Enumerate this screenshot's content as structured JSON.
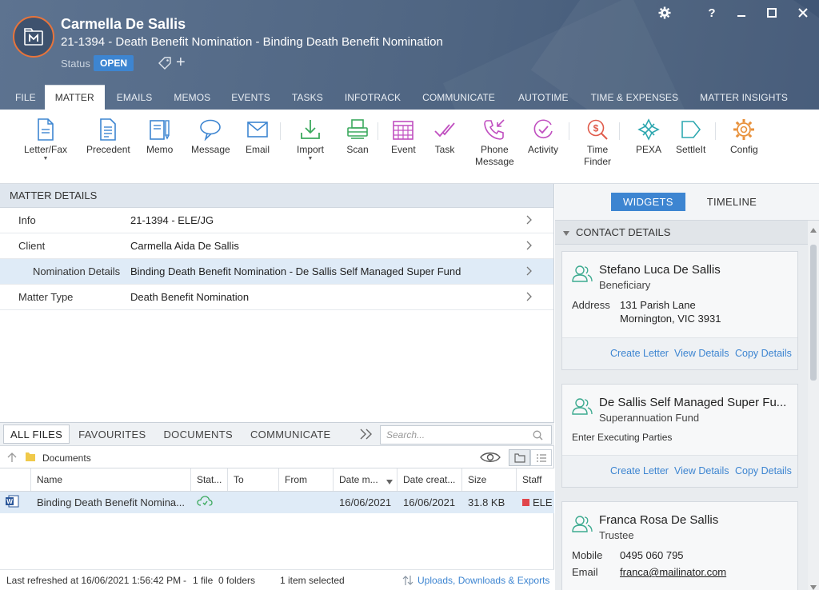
{
  "header": {
    "client_name": "Carmella De Sallis",
    "matter_title": "21-1394 - Death Benefit Nomination - Binding Death Benefit Nomination",
    "status_label": "Status",
    "status_value": "OPEN",
    "colors": {
      "accent": "#e8743b",
      "badge": "#3d85d1",
      "header_bg": "#56708f"
    }
  },
  "window_controls": {
    "settings": "gear-icon",
    "help": "?",
    "minimize": "minimize-icon",
    "maximize": "maximize-icon",
    "close": "close-icon"
  },
  "tabs": [
    {
      "label": "FILE"
    },
    {
      "label": "MATTER",
      "active": true
    },
    {
      "label": "EMAILS"
    },
    {
      "label": "MEMOS"
    },
    {
      "label": "EVENTS"
    },
    {
      "label": "TASKS"
    },
    {
      "label": "INFOTRACK"
    },
    {
      "label": "COMMUNICATE"
    },
    {
      "label": "AUTOTIME"
    },
    {
      "label": "TIME & EXPENSES"
    },
    {
      "label": "MATTER INSIGHTS"
    }
  ],
  "ribbon": {
    "letter_fax": "Letter/Fax",
    "precedent": "Precedent",
    "memo": "Memo",
    "message": "Message",
    "email": "Email",
    "import": "Import",
    "scan": "Scan",
    "event": "Event",
    "task": "Task",
    "phone_message_1": "Phone",
    "phone_message_2": "Message",
    "activity": "Activity",
    "time_finder_1": "Time",
    "time_finder_2": "Finder",
    "pexa": "PEXA",
    "settleit": "SettleIt",
    "config": "Config"
  },
  "matter_details": {
    "title": "MATTER DETAILS",
    "rows": [
      {
        "label": "Info",
        "value": "21-1394 - ELE/JG"
      },
      {
        "label": "Client",
        "value": "Carmella Aida De Sallis"
      },
      {
        "label": "Nomination Details",
        "value": "Binding Death Benefit Nomination - De Sallis Self Managed Super Fund"
      },
      {
        "label": "Matter Type",
        "value": "Death Benefit Nomination"
      }
    ]
  },
  "files": {
    "tabs": [
      "ALL FILES",
      "FAVOURITES",
      "DOCUMENTS",
      "COMMUNICATE"
    ],
    "search_placeholder": "Search...",
    "folder": "Documents",
    "columns": [
      "Name",
      "Stat...",
      "To",
      "From",
      "Date m...",
      "Date creat...",
      "Size",
      "Staff"
    ],
    "rows": [
      {
        "name": "Binding Death Benefit Nomina...",
        "to": "",
        "from": "",
        "date_modified": "16/06/2021",
        "date_created": "16/06/2021",
        "size": "31.8 KB",
        "staff": "ELE"
      }
    ]
  },
  "statusbar": {
    "refreshed": "Last refreshed at 16/06/2021 1:56:42 PM",
    "sep": "-",
    "file_count": "1 file",
    "folder_count": "0 folders",
    "selected": "1 item selected",
    "uploads": "Uploads, Downloads & Exports"
  },
  "right_panel": {
    "tab_widgets": "WIDGETS",
    "tab_timeline": "TIMELINE",
    "section_title": "CONTACT DETAILS",
    "contacts": [
      {
        "name": "Stefano Luca De Sallis",
        "role": "Beneficiary",
        "field_label": "Address",
        "line1": "131 Parish Lane",
        "line2": "Mornington, VIC 3931"
      },
      {
        "name": "De Sallis Self Managed Super Fu...",
        "role": "Superannuation Fund",
        "link": "Enter Executing Parties"
      },
      {
        "name": "Franca Rosa De Sallis",
        "role": "Trustee",
        "field_label": "Mobile",
        "mobile": "0495 060 795",
        "field_label2": "Email",
        "email": "franca@mailinator.com"
      }
    ],
    "actions": {
      "create_letter": "Create Letter",
      "view_details": "View Details",
      "copy_details": "Copy Details"
    }
  }
}
